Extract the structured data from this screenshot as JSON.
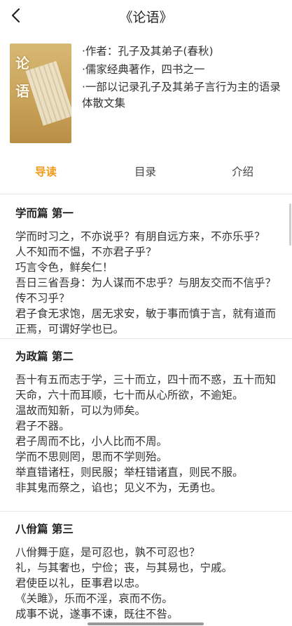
{
  "header": {
    "title": "《论语》"
  },
  "cover": {
    "char1": "论",
    "char2": "语"
  },
  "meta": {
    "author": "·作者：孔子及其弟子(春秋)",
    "classic": "·儒家经典著作，四书之一",
    "desc": "·一部以记录孔子及其弟子言行为主的语录体散文集"
  },
  "tabs": {
    "guide": "导读",
    "toc": "目录",
    "intro": "介绍"
  },
  "sections": [
    {
      "title": "学而篇 第一",
      "lines": [
        "学而时习之，不亦说乎？有朋自远方来，不亦乐乎？",
        "人不知而不愠，不亦君子乎？",
        "巧言令色，鲜矣仁！",
        "吾日三省吾身：为人谋而不忠乎？与朋友交而不信乎？传不习乎？",
        "君子食无求饱，居无求安，敏于事而慎于言，就有道而正焉，可谓好学也已。"
      ]
    },
    {
      "title": "为政篇 第二",
      "lines": [
        "吾十有五而志于学，三十而立，四十而不惑，五十而知天命，六十而耳顺，七十而从心所欲，不逾矩。",
        "温故而知新，可以为师矣。",
        "君子不器。",
        "君子周而不比，小人比而不周。",
        "学而不思则罔，思而不学则殆。",
        "举直错诸枉，则民服；举枉错诸直，则民不服。",
        "非其鬼而祭之，谄也；见义不为，无勇也。"
      ]
    },
    {
      "title": "八佾篇 第三",
      "lines": [
        "八佾舞于庭，是可忍也，孰不可忍也？",
        "礼，与其奢也，宁俭；丧，与其易也，宁戚。",
        "君使臣以礼，臣事君以忠。",
        "《关雎》，乐而不淫，哀而不伤。",
        "成事不说，遂事不谏，既往不咎。"
      ]
    }
  ]
}
